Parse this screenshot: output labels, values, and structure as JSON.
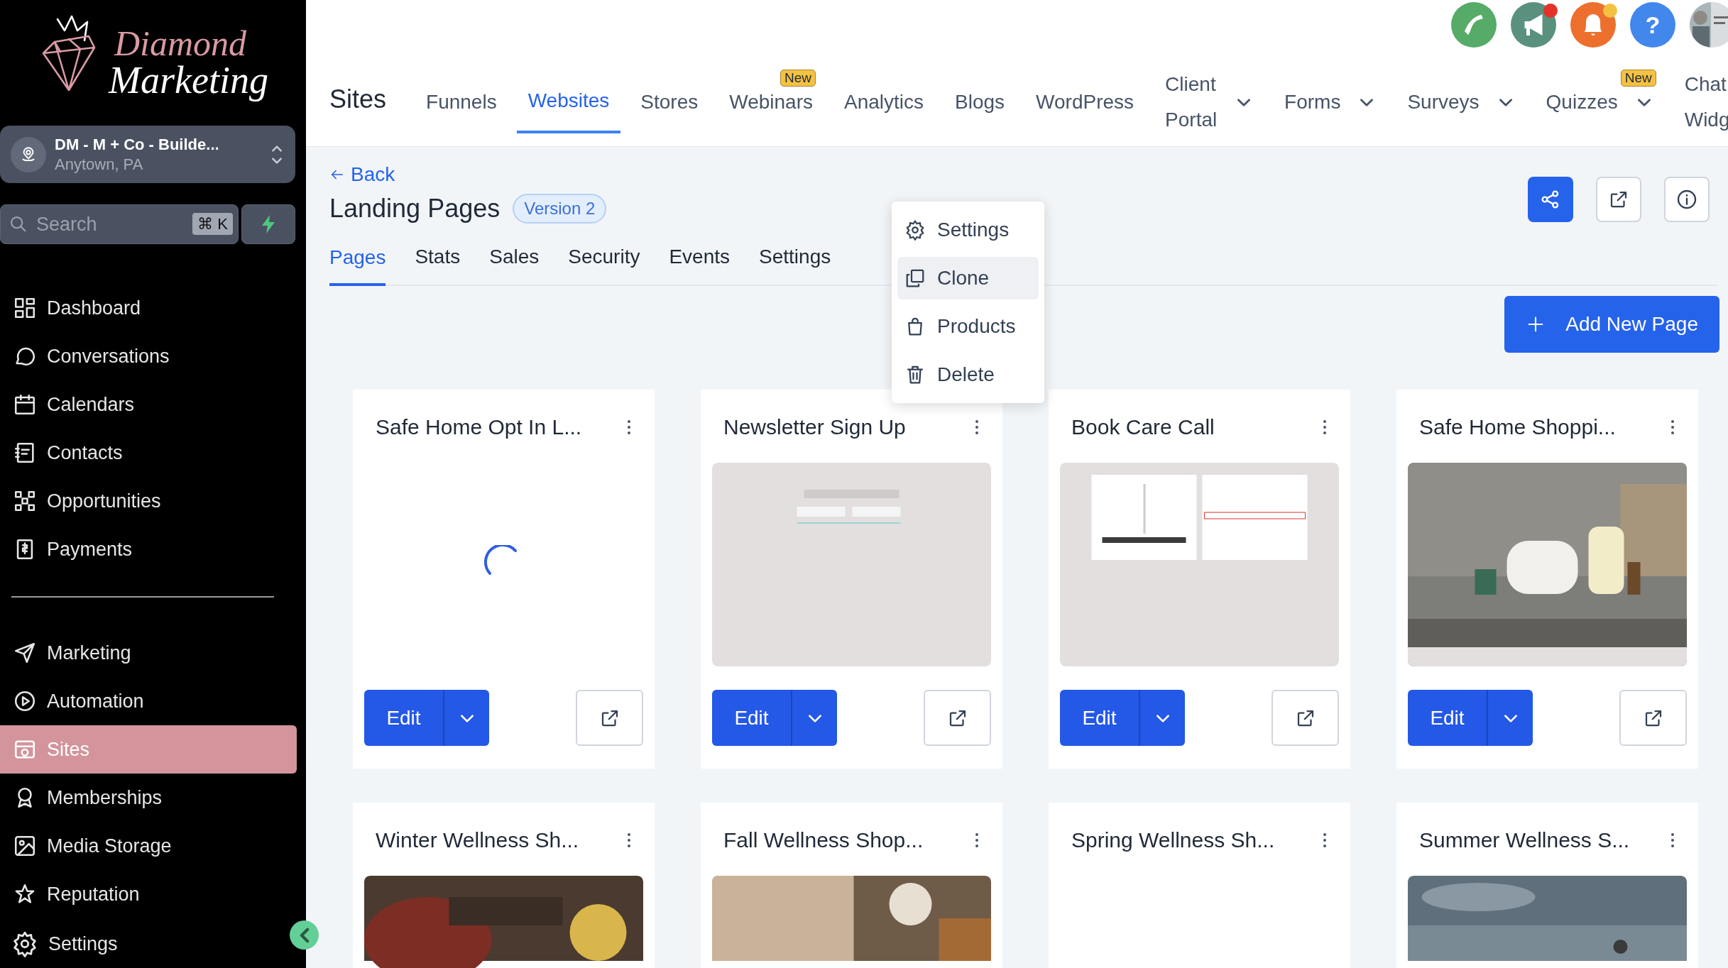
{
  "logo": {
    "line_1": "Diamond",
    "line_2": "Marketing"
  },
  "account": {
    "name": "DM - M + Co - Builde...",
    "location": "Anytown, PA"
  },
  "search": {
    "placeholder": "Search",
    "shortcut": "⌘ K"
  },
  "sidebar": {
    "items": [
      {
        "label": "Dashboard",
        "selected": false
      },
      {
        "label": "Conversations",
        "selected": false
      },
      {
        "label": "Calendars",
        "selected": false
      },
      {
        "label": "Contacts",
        "selected": false
      },
      {
        "label": "Opportunities",
        "selected": false
      },
      {
        "label": "Payments",
        "selected": false
      }
    ],
    "items_2": [
      {
        "label": "Marketing",
        "selected": false
      },
      {
        "label": "Automation",
        "selected": false
      },
      {
        "label": "Sites",
        "selected": true
      },
      {
        "label": "Memberships",
        "selected": false
      },
      {
        "label": "Media Storage",
        "selected": false
      },
      {
        "label": "Reputation",
        "selected": false
      }
    ],
    "settings": "Settings"
  },
  "top_nav": {
    "title": "Sites",
    "tabs": [
      {
        "label": "Funnels",
        "selected": false
      },
      {
        "label": "Websites",
        "selected": true
      },
      {
        "label": "Stores",
        "selected": false
      },
      {
        "label": "Webinars",
        "selected": false,
        "badge": "New"
      },
      {
        "label": "Analytics",
        "selected": false
      },
      {
        "label": "Blogs",
        "selected": false
      },
      {
        "label": "WordPress",
        "selected": false
      },
      {
        "label": "Client Portal",
        "selected": false,
        "dropdown": true
      },
      {
        "label": "Forms",
        "selected": false,
        "dropdown": true
      },
      {
        "label": "Surveys",
        "selected": false,
        "dropdown": true
      },
      {
        "label": "Quizzes",
        "selected": false,
        "dropdown": true,
        "badge": "New"
      },
      {
        "label": "Chat Widg",
        "selected": false
      }
    ]
  },
  "header_icons": [
    {
      "color": "#56ab68"
    },
    {
      "color": "#5a917e",
      "dot": {
        "color": "#e5322a"
      }
    },
    {
      "color": "#ed6f2d",
      "dot": {
        "color": "#f4c242"
      }
    },
    {
      "color": "#4287ec"
    }
  ],
  "help_label": "?",
  "back": "Back",
  "page": {
    "title": "Landing Pages",
    "version": "Version 2"
  },
  "tabs": [
    {
      "label": "Pages",
      "selected": true
    },
    {
      "label": "Stats",
      "selected": false
    },
    {
      "label": "Sales",
      "selected": false
    },
    {
      "label": "Security",
      "selected": false
    },
    {
      "label": "Events",
      "selected": false
    },
    {
      "label": "Settings",
      "selected": false
    }
  ],
  "menu": [
    {
      "label": "Settings",
      "selected": false
    },
    {
      "label": "Clone",
      "selected": true
    },
    {
      "label": "Products",
      "selected": false
    },
    {
      "label": "Delete",
      "selected": false
    }
  ],
  "add_button": "Add New Page",
  "cards": [
    {
      "title": "Safe Home Opt In L...",
      "kind": "loading",
      "edit": "Edit"
    },
    {
      "title": "Newsletter Sign Up",
      "kind": "picture",
      "edit": "Edit"
    },
    {
      "title": "Book Care Call",
      "kind": "picture",
      "edit": "Edit"
    },
    {
      "title": "Safe Home Shoppi...",
      "kind": "picture",
      "edit": "Edit"
    },
    {
      "title": "Winter Wellness Sh...",
      "kind": "picture"
    },
    {
      "title": "Fall Wellness Shop...",
      "kind": "picture"
    },
    {
      "title": "Spring Wellness Sh...",
      "kind": "empty"
    },
    {
      "title": "Summer Wellness S...",
      "kind": "picture"
    }
  ]
}
